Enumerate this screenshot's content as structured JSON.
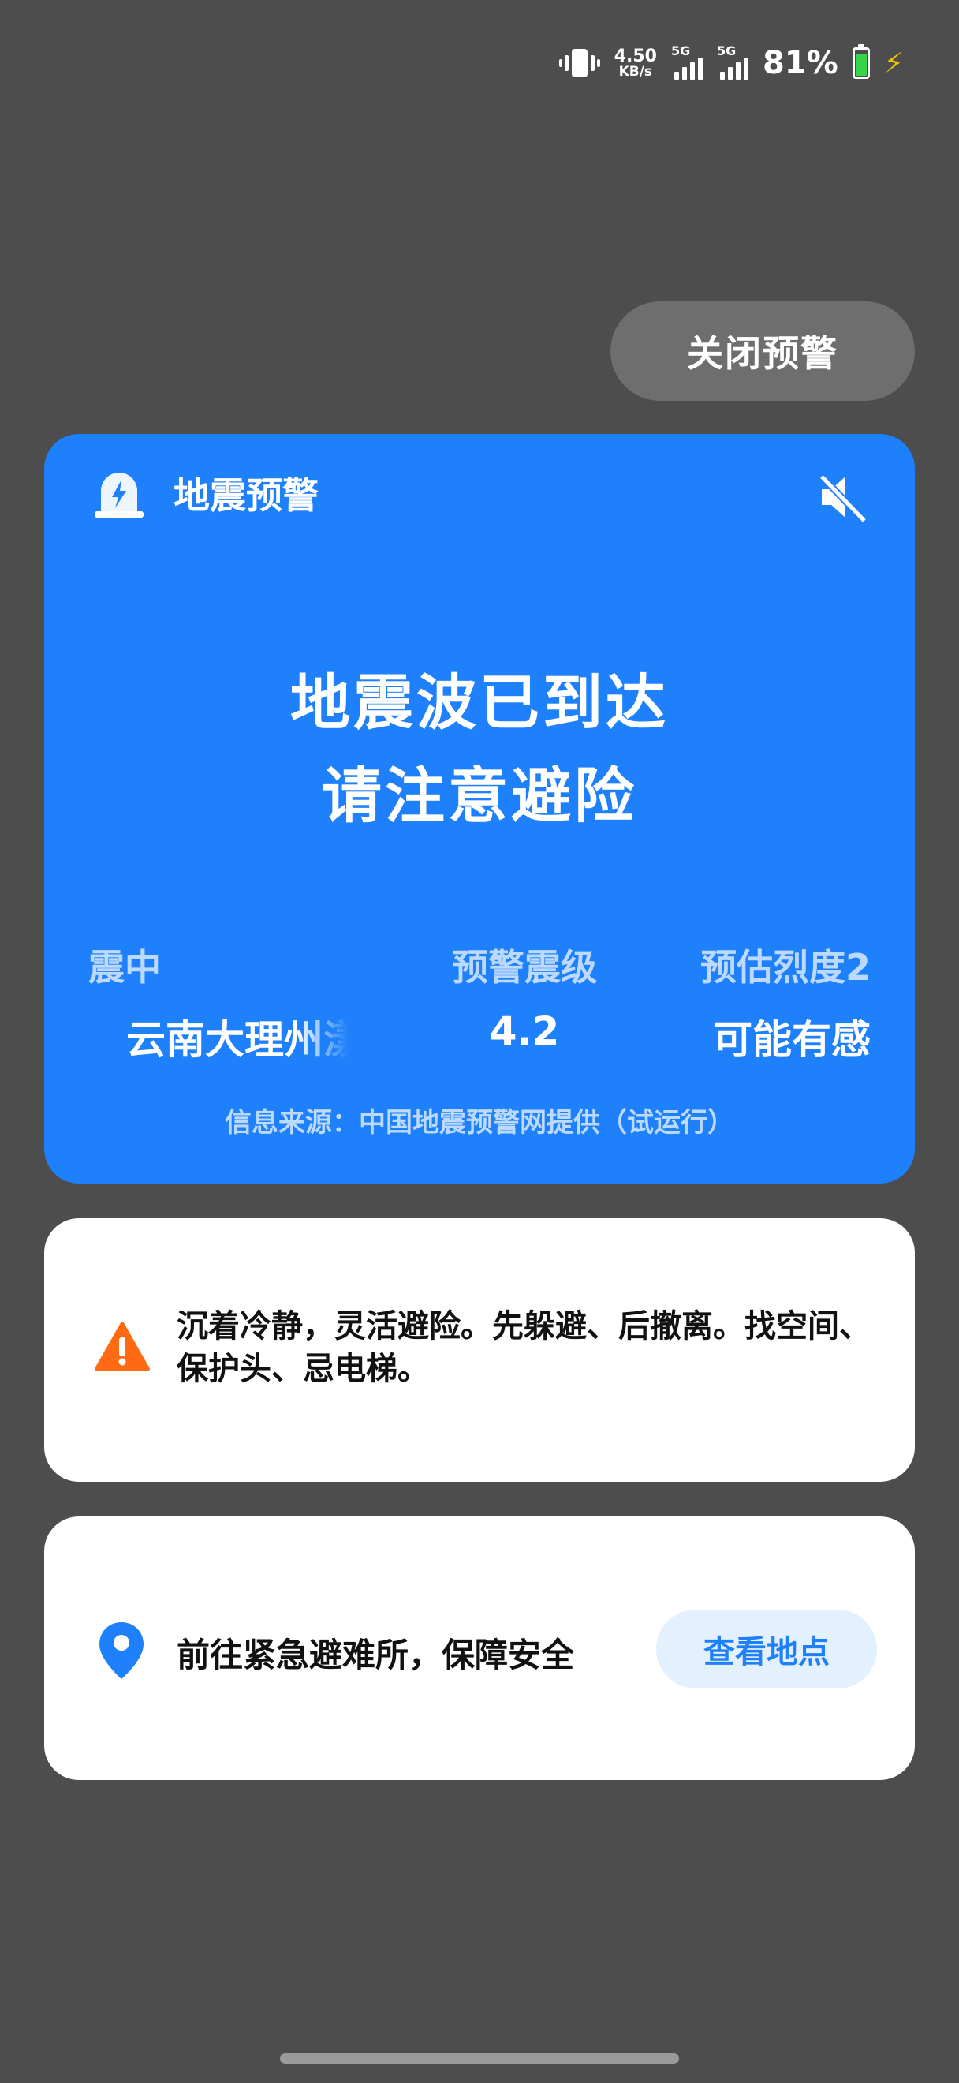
{
  "status_bar": {
    "net_speed_value": "4.50",
    "net_speed_unit": "KB/s",
    "sim1_tag": "5G",
    "sim2_tag": "5G",
    "battery_percent": "81%",
    "battery_level": 0.81,
    "charging": true
  },
  "close_button": {
    "label": "关闭预警"
  },
  "alert": {
    "title": "地震预警",
    "icon": "earthquake-alert-icon",
    "mute_icon": "volume-muted-icon",
    "headline_line1": "地震波已到达",
    "headline_line2": "请注意避险",
    "epicenter_label": "震中",
    "epicenter_value": "云南大理州漾",
    "magnitude_label": "预警震级",
    "magnitude_value": "4.2",
    "intensity_label": "预估烈度2",
    "intensity_value": "可能有感",
    "source": "信息来源：中国地震预警网提供（试运行）",
    "card_color": "#1f80fb"
  },
  "advice": {
    "icon": "warning-triangle-icon",
    "text": "沉着冷静，灵活避险。先躲避、后撤离。找空间、保护头、忌电梯。"
  },
  "shelter": {
    "icon": "location-pin-icon",
    "text": "前往紧急避难所，保障安全",
    "button_label": "查看地点"
  }
}
